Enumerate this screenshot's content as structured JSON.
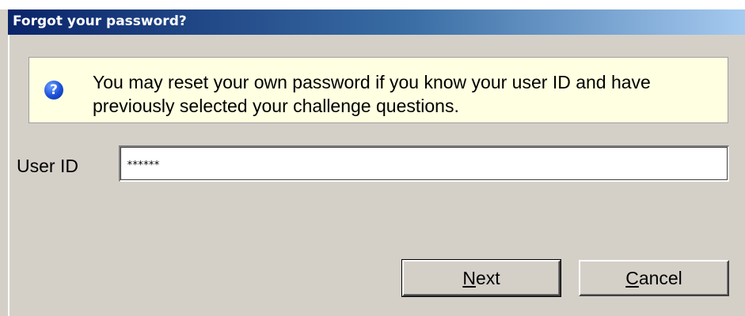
{
  "dialog": {
    "title": "Forgot your password?",
    "info_icon": "question-mark-icon",
    "info_message": "You may reset your own password if you know your user ID and have previously selected your challenge questions."
  },
  "form": {
    "user_id_label": "User ID",
    "user_id_value": "******"
  },
  "buttons": {
    "next_label_mnemonic": "N",
    "next_label_rest": "ext",
    "cancel_label_mnemonic": "C",
    "cancel_label_rest": "ancel"
  },
  "colors": {
    "title_gradient_start": "#0a246a",
    "title_gradient_end": "#a6caf0",
    "info_background": "#ffffe1",
    "dialog_background": "#d4d0c8"
  }
}
